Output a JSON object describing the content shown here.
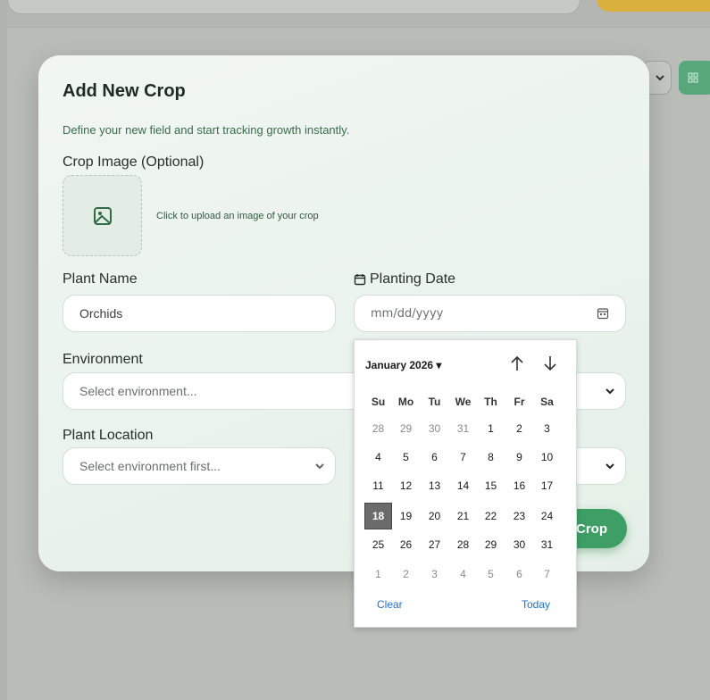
{
  "modal": {
    "title": "Add New Crop",
    "subtitle": "Define your new field and start tracking growth instantly.",
    "image_label": "Crop Image (Optional)",
    "upload_hint": "Click to upload an image of your crop",
    "plant_name": {
      "label": "Plant Name",
      "value": "Orchids"
    },
    "planting_date": {
      "label": "Planting Date",
      "placeholder": "mm/dd/yyyy"
    },
    "environment": {
      "label": "Environment",
      "placeholder": "Select environment..."
    },
    "plant_location": {
      "label": "Plant Location",
      "placeholder": "Select environment first..."
    },
    "submit_label": "Crop"
  },
  "datepicker": {
    "month_label": "January 2026 ▾",
    "weekdays": [
      "Su",
      "Mo",
      "Tu",
      "We",
      "Th",
      "Fr",
      "Sa"
    ],
    "weeks": [
      [
        "28",
        "29",
        "30",
        "31",
        "1",
        "2",
        "3"
      ],
      [
        "4",
        "5",
        "6",
        "7",
        "8",
        "9",
        "10"
      ],
      [
        "11",
        "12",
        "13",
        "14",
        "15",
        "16",
        "17"
      ],
      [
        "18",
        "19",
        "20",
        "21",
        "22",
        "23",
        "24"
      ],
      [
        "25",
        "26",
        "27",
        "28",
        "29",
        "30",
        "31"
      ],
      [
        "1",
        "2",
        "3",
        "4",
        "5",
        "6",
        "7"
      ]
    ],
    "selected_day": "18",
    "clear_label": "Clear",
    "today_label": "Today"
  },
  "colors": {
    "accent_green": "#3d9f66",
    "accent_yellow": "#d9b03e",
    "link_blue": "#1e6fd0"
  }
}
